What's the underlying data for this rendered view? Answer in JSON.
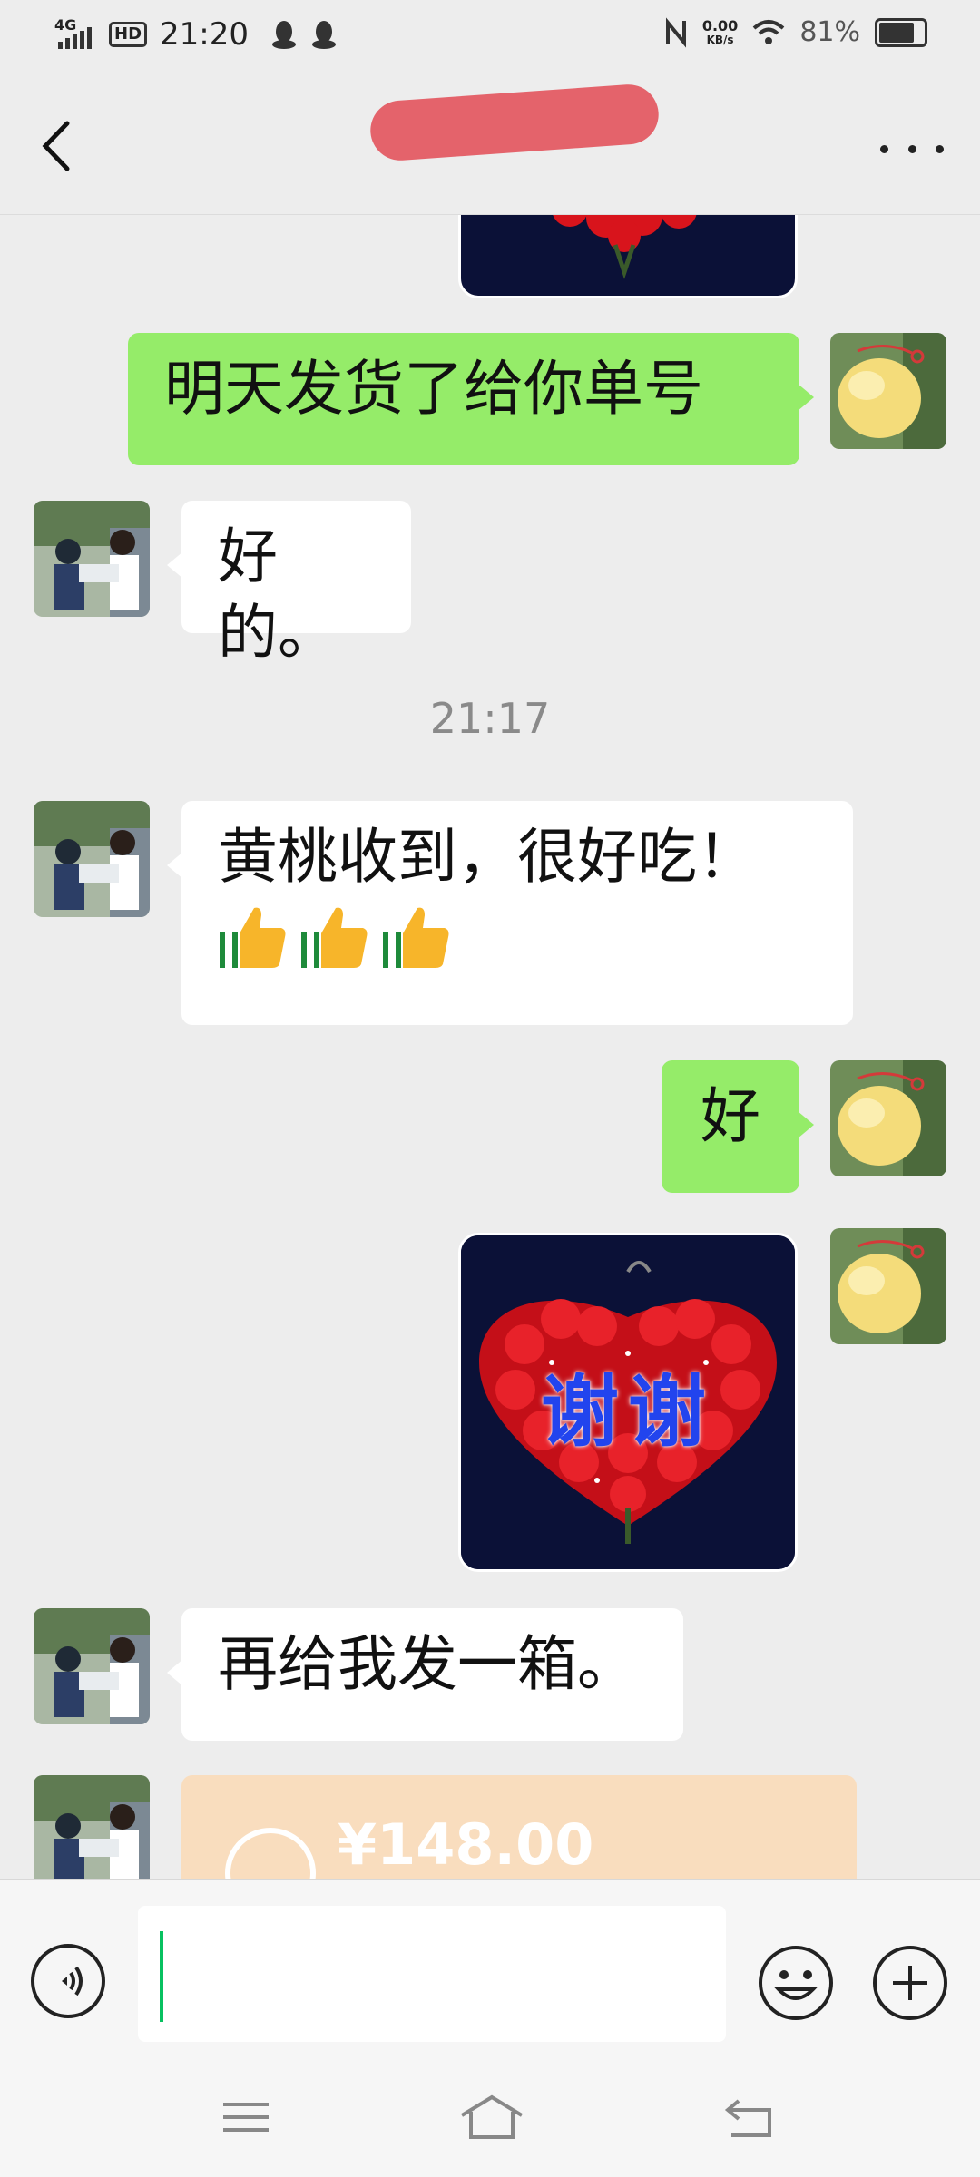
{
  "status_bar": {
    "network": "4G",
    "hd": "HD",
    "time": "21:20",
    "speed_value": "0.00",
    "speed_unit": "KB/s",
    "battery": "81%"
  },
  "header": {
    "title": "",
    "back_icon": "chevron-left-icon",
    "more_icon": "more-dots-icon"
  },
  "messages": [
    {
      "side": "me",
      "type": "text",
      "text": "明天发货了给你单号"
    },
    {
      "side": "other",
      "type": "text",
      "text": "好的。"
    },
    {
      "type": "time",
      "text": "21:17"
    },
    {
      "side": "other",
      "type": "text",
      "text": "黄桃收到，很好吃！",
      "emoji": "thumbs-up x3"
    },
    {
      "side": "me",
      "type": "text",
      "text": "好"
    },
    {
      "side": "me",
      "type": "sticker",
      "text": "谢谢"
    },
    {
      "side": "other",
      "type": "text",
      "text": "再给我发一箱。"
    },
    {
      "side": "other",
      "type": "transfer",
      "text": "¥148.00"
    }
  ],
  "input_bar": {
    "value": "",
    "voice_icon": "voice-icon",
    "emoji_icon": "emoji-icon",
    "plus_icon": "plus-icon"
  },
  "nav_bar": {
    "icons": [
      "menu-icon",
      "home-icon",
      "back-arrow-icon"
    ]
  },
  "colors": {
    "my_bubble": "#95ec69",
    "their_bubble": "#ffffff",
    "background": "#ededed",
    "transfer_card": "#f9ddbe"
  }
}
